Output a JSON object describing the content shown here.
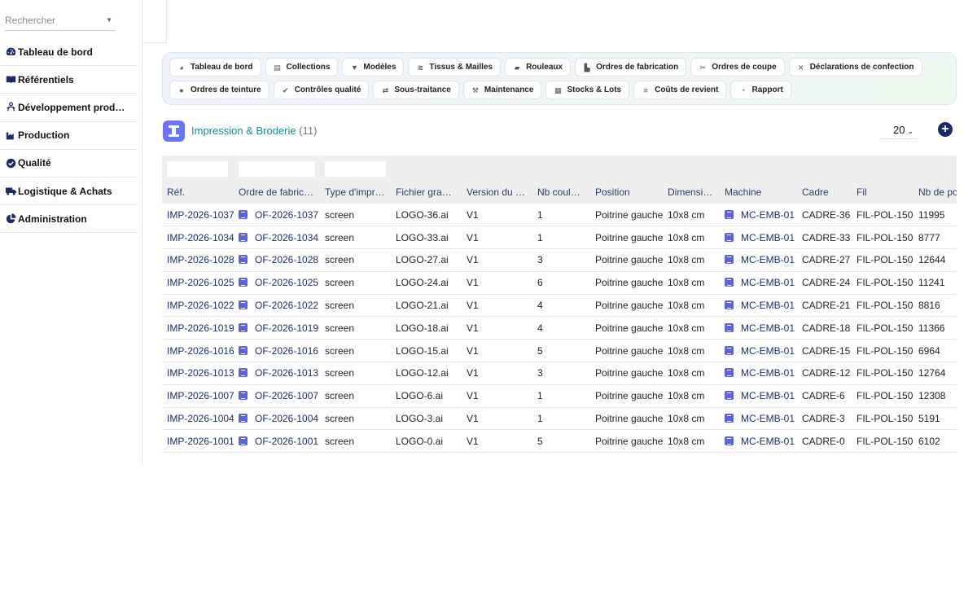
{
  "search": {
    "placeholder": "Rechercher"
  },
  "sidebar": {
    "items": [
      {
        "label": "Tableau de bord",
        "icon": "dashboard-icon"
      },
      {
        "label": "Référentiels",
        "icon": "book-icon"
      },
      {
        "label": "Développement prod…",
        "icon": "people-icon"
      },
      {
        "label": "Production",
        "icon": "factory-icon"
      },
      {
        "label": "Qualité",
        "icon": "check-circle-icon"
      },
      {
        "label": "Logistique & Achats",
        "icon": "truck-icon"
      },
      {
        "label": "Administration",
        "icon": "pie-chart-icon"
      }
    ]
  },
  "modules": {
    "row1": [
      {
        "label": "Tableau de bord",
        "icon": "dashboard-icon"
      },
      {
        "label": "Collections",
        "icon": "book-icon"
      },
      {
        "label": "Modèles",
        "icon": "shirt-icon"
      },
      {
        "label": "Tissus & Mailles",
        "icon": "layers-icon"
      },
      {
        "label": "Rouleaux",
        "icon": "roll-icon"
      },
      {
        "label": "Ordres de fabrication",
        "icon": "factory-icon"
      },
      {
        "label": "Ordres de coupe",
        "icon": "scissors-icon"
      },
      {
        "label": "Déclarations de confection",
        "icon": "tools-icon"
      }
    ],
    "row2": [
      {
        "label": "Ordres de teinture",
        "icon": "drop-icon"
      },
      {
        "label": "Contrôles qualité",
        "icon": "check-circle-icon"
      },
      {
        "label": "Sous-traitance",
        "icon": "handshake-icon"
      },
      {
        "label": "Maintenance",
        "icon": "wrench-icon"
      },
      {
        "label": "Stocks & Lots",
        "icon": "warehouse-icon"
      },
      {
        "label": "Coûts de revient",
        "icon": "coins-icon"
      },
      {
        "label": "Rapport",
        "icon": "pie-chart-icon"
      }
    ]
  },
  "list": {
    "title": "Impression & Broderie",
    "count": "(11)",
    "page_size": "20"
  },
  "table": {
    "columns": [
      "Réf.",
      "Ordre de fabrica…",
      "Type d'impre…",
      "Fichier grap…",
      "Version du d…",
      "Nb couleurs",
      "Position",
      "Dimensions",
      "Machine",
      "Cadre",
      "Fil",
      "Nb de points"
    ],
    "rows": [
      [
        "IMP-2026-1037",
        "OF-2026-1037",
        "screen",
        "LOGO-36.ai",
        "V1",
        "1",
        "Poitrine gauche",
        "10x8 cm",
        "MC-EMB-01",
        "CADRE-36",
        "FIL-POL-150",
        "11995"
      ],
      [
        "IMP-2026-1034",
        "OF-2026-1034",
        "screen",
        "LOGO-33.ai",
        "V1",
        "1",
        "Poitrine gauche",
        "10x8 cm",
        "MC-EMB-01",
        "CADRE-33",
        "FIL-POL-150",
        "8777"
      ],
      [
        "IMP-2026-1028",
        "OF-2026-1028",
        "screen",
        "LOGO-27.ai",
        "V1",
        "3",
        "Poitrine gauche",
        "10x8 cm",
        "MC-EMB-01",
        "CADRE-27",
        "FIL-POL-150",
        "12644"
      ],
      [
        "IMP-2026-1025",
        "OF-2026-1025",
        "screen",
        "LOGO-24.ai",
        "V1",
        "6",
        "Poitrine gauche",
        "10x8 cm",
        "MC-EMB-01",
        "CADRE-24",
        "FIL-POL-150",
        "11241"
      ],
      [
        "IMP-2026-1022",
        "OF-2026-1022",
        "screen",
        "LOGO-21.ai",
        "V1",
        "4",
        "Poitrine gauche",
        "10x8 cm",
        "MC-EMB-01",
        "CADRE-21",
        "FIL-POL-150",
        "8816"
      ],
      [
        "IMP-2026-1019",
        "OF-2026-1019",
        "screen",
        "LOGO-18.ai",
        "V1",
        "4",
        "Poitrine gauche",
        "10x8 cm",
        "MC-EMB-01",
        "CADRE-18",
        "FIL-POL-150",
        "11366"
      ],
      [
        "IMP-2026-1016",
        "OF-2026-1016",
        "screen",
        "LOGO-15.ai",
        "V1",
        "5",
        "Poitrine gauche",
        "10x8 cm",
        "MC-EMB-01",
        "CADRE-15",
        "FIL-POL-150",
        "6964"
      ],
      [
        "IMP-2026-1013",
        "OF-2026-1013",
        "screen",
        "LOGO-12.ai",
        "V1",
        "3",
        "Poitrine gauche",
        "10x8 cm",
        "MC-EMB-01",
        "CADRE-12",
        "FIL-POL-150",
        "12764"
      ],
      [
        "IMP-2026-1007",
        "OF-2026-1007",
        "screen",
        "LOGO-6.ai",
        "V1",
        "1",
        "Poitrine gauche",
        "10x8 cm",
        "MC-EMB-01",
        "CADRE-6",
        "FIL-POL-150",
        "12308"
      ],
      [
        "IMP-2026-1004",
        "OF-2026-1004",
        "screen",
        "LOGO-3.ai",
        "V1",
        "1",
        "Poitrine gauche",
        "10x8 cm",
        "MC-EMB-01",
        "CADRE-3",
        "FIL-POL-150",
        "5191"
      ],
      [
        "IMP-2026-1001",
        "OF-2026-1001",
        "screen",
        "LOGO-0.ai",
        "V1",
        "5",
        "Poitrine gauche",
        "10x8 cm",
        "MC-EMB-01",
        "CADRE-0",
        "FIL-POL-150",
        "6102"
      ]
    ]
  },
  "colors": {
    "accent": "#1b2e6e",
    "title": "#1d8787",
    "module_logo": "#6a70f3"
  }
}
